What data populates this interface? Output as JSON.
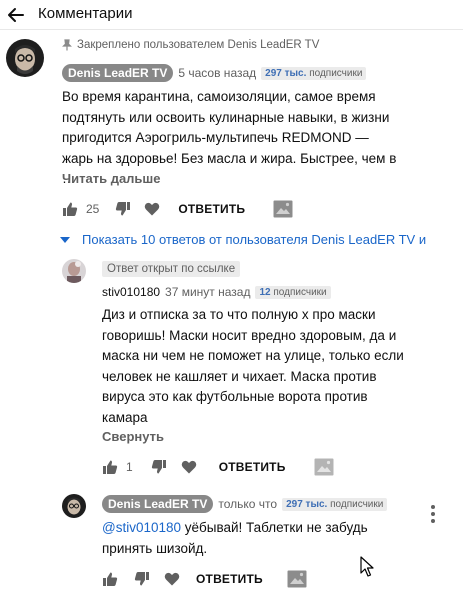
{
  "header": {
    "title": "Комментарии"
  },
  "pinned_comment": {
    "pinned_text": "Закреплено пользователем Denis LeadER TV",
    "author": "Denis LeadER TV",
    "time": "5 часов назад",
    "subs_count": "297 тыс.",
    "subs_label": "подписчики",
    "text": "Во время карантина, самоизоляции, самое время подтянуть или освоить кулинарные навыки, в жизни пригодится Аэрогриль-мультипечь REDMOND — жарь на здоровье! Без масла и жира. Быстрее, чем в …",
    "read_more": "Читать дальше",
    "like_count": "25",
    "reply_label": "ОТВЕТИТЬ"
  },
  "show_replies": "Показать 10 ответов от пользователя Denis LeadER TV и",
  "reply_1": {
    "linked_label": "Ответ открыт по ссылке",
    "author": "stiv010180",
    "time": "37 минут назад",
    "subs_count": "12",
    "subs_label": "подписчики",
    "text": "Диз и отписка за то что полную х про маски говоришь! Маски носит вредно здоровым, да и маска ни чем не поможет на улице, только если человек не кашляет и чихает. Маска против вируса это как футбольные ворота против камара",
    "collapse": "Свернуть",
    "like_count": "1",
    "reply_label": "ОТВЕТИТЬ"
  },
  "reply_2": {
    "author": "Denis LeadER TV",
    "time": "только что",
    "subs_count": "297 тыс.",
    "subs_label": "подписчики",
    "mention": "@stiv010180",
    "text": " уёбывай! Таблетки не забудь принять шизойд.",
    "reply_label": "ОТВЕТИТЬ"
  },
  "colors": {
    "link_blue": "#1a66c9",
    "chip_gray": "#888888",
    "meta_gray": "#606060"
  }
}
